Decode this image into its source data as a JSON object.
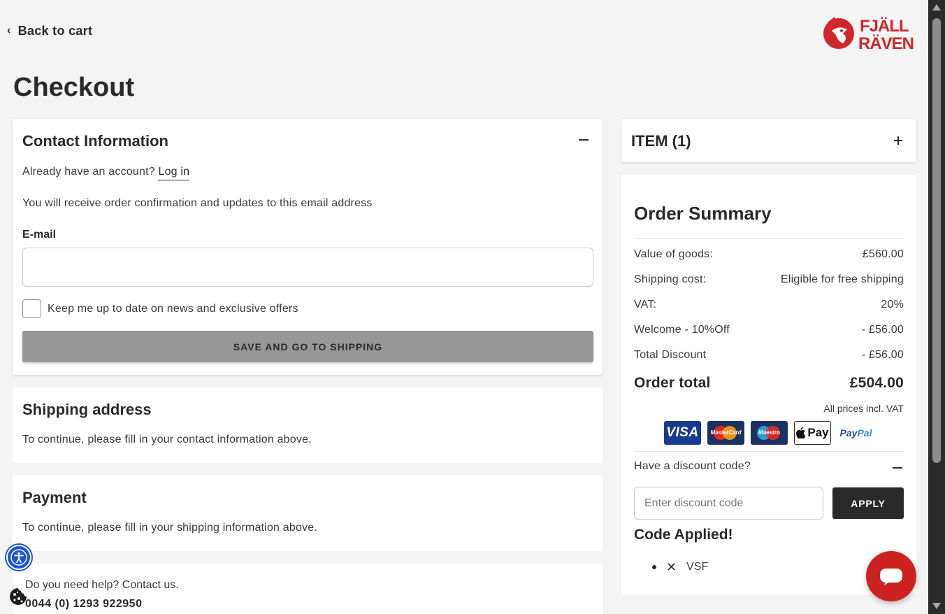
{
  "header": {
    "back_label": "Back to cart",
    "brand_line1": "FJÄLL",
    "brand_line2": "RÄVEN",
    "brand_color": "#d0262c"
  },
  "page_title": "Checkout",
  "contact": {
    "title": "Contact Information",
    "account_prompt": "Already have an account?",
    "login_label": "Log in",
    "confirm_text": "You will receive order confirmation and updates to this email address",
    "email_label": "E-mail",
    "email_value": "",
    "newsletter_label": "Keep me up to date on news and exclusive offers",
    "newsletter_checked": false,
    "submit_label": "SAVE AND GO TO SHIPPING"
  },
  "shipping": {
    "title": "Shipping address",
    "text": "To continue, please fill in your contact information above."
  },
  "payment": {
    "title": "Payment",
    "text": "To continue, please fill in your shipping information above."
  },
  "help": {
    "text": "Do you need help? Contact us.",
    "phone": "0044 (0) 1293 922950"
  },
  "items": {
    "title": "ITEM (1)"
  },
  "summary": {
    "title": "Order Summary",
    "rows": [
      {
        "label": "Value of goods:",
        "value": "£560.00"
      },
      {
        "label": "Shipping cost:",
        "value": "Eligible for free shipping"
      },
      {
        "label": "VAT:",
        "value": "20%"
      },
      {
        "label": "Welcome - 10%Off",
        "value": "- £56.00"
      },
      {
        "label": "Total Discount",
        "value": "- £56.00"
      }
    ],
    "total_label": "Order total",
    "total_value": "£504.00",
    "vat_note": "All prices incl. VAT",
    "payment_methods": {
      "visa": "VISA",
      "mastercard": "MasterCard",
      "maestro": "Maestro",
      "applepay": "Pay",
      "paypal_pay": "Pay",
      "paypal_pal": "Pal"
    },
    "discount_question": "Have a discount code?",
    "discount_placeholder": "Enter discount code",
    "apply_label": "APPLY",
    "code_applied_title": "Code Applied!",
    "applied_code": "VSF"
  },
  "colors": {
    "background": "#f4f4f4",
    "accent_red": "#cc2222",
    "disabled_button": "#979797",
    "dark_button": "#2a2a2a",
    "accessibility_blue": "#1d56d6"
  }
}
